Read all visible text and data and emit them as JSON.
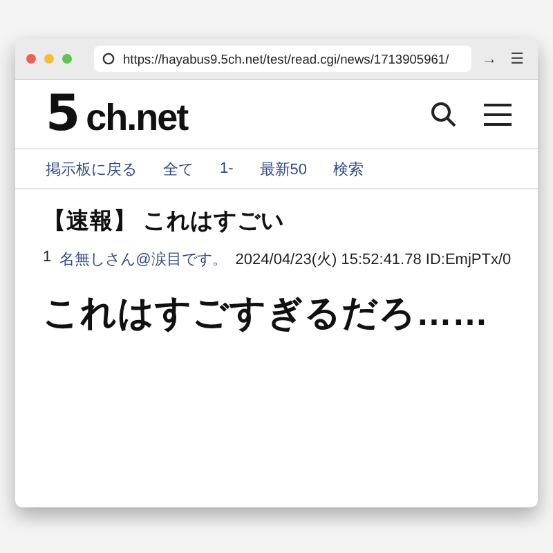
{
  "browser": {
    "url": "https://hayabus9.5ch.net/test/read.cgi/news/1713905961/",
    "go": "→",
    "menu": "☰"
  },
  "site": {
    "logo_mark": "5",
    "logo_text": "ch.net"
  },
  "nav": [
    "掲示板に戻る",
    "全て",
    "1-",
    "最新50",
    "検索"
  ],
  "thread": {
    "title": "【速報】 これはすごい",
    "posts": [
      {
        "number": "1",
        "name": "名無しさん@涙目です。",
        "meta": "2024/04/23(火) 15:52:41.78 ID:EmjPTx/0",
        "body": "これはすごすぎるだろ……"
      }
    ]
  }
}
